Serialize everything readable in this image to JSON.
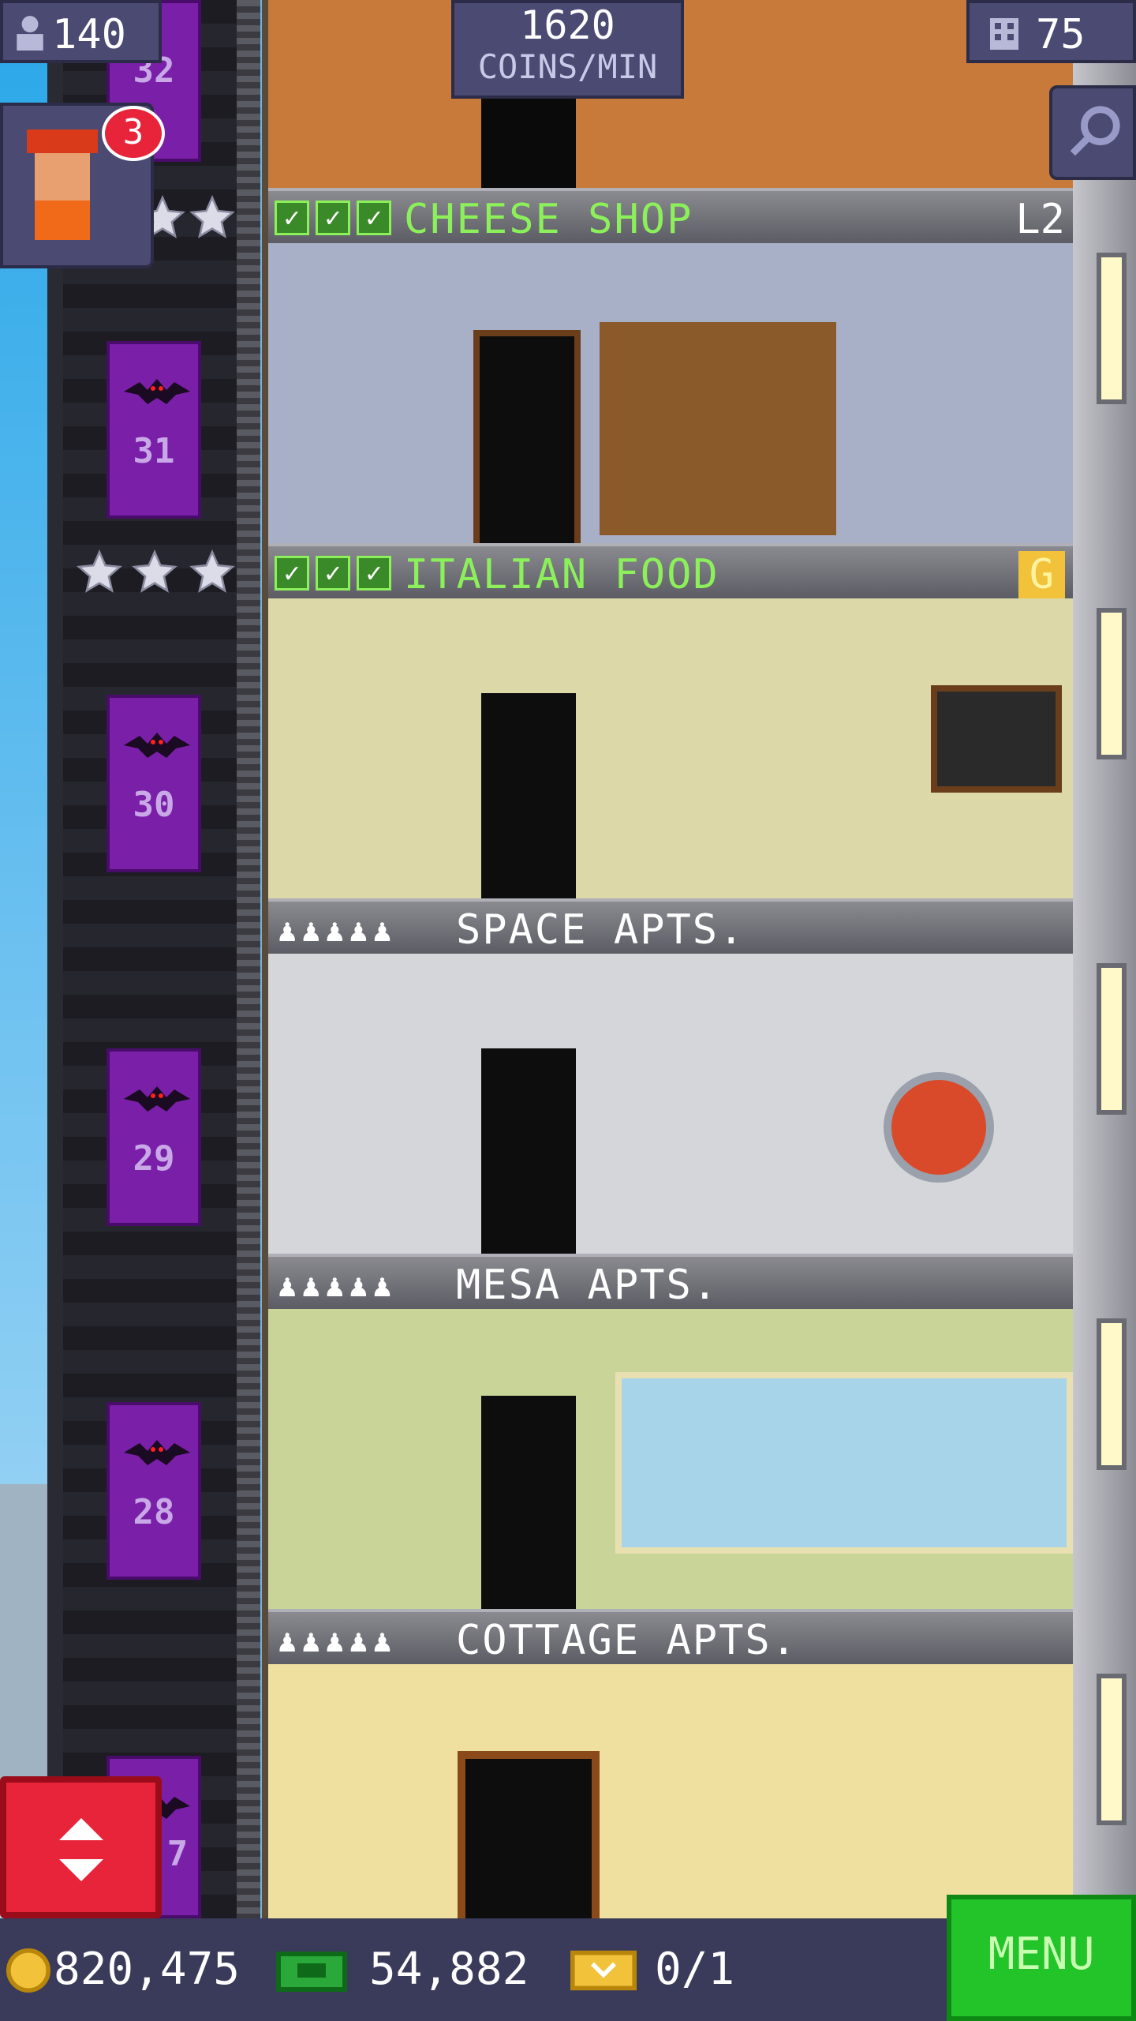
{
  "hud": {
    "population": "140",
    "coins_rate_value": "1620",
    "coins_rate_unit": "COINS/MIN",
    "floors_count": "75",
    "visitor_badge": "3"
  },
  "floors": [
    {
      "name": "CHEESE SHOP",
      "type": "business",
      "right_label": "L2",
      "elevator_number": "31"
    },
    {
      "name": "ITALIAN FOOD",
      "type": "business",
      "right_label": "G",
      "elevator_number": "30"
    },
    {
      "name": "SPACE APTS.",
      "type": "residential",
      "elevator_number": "29"
    },
    {
      "name": "MESA APTS.",
      "type": "residential",
      "elevator_number": "28"
    },
    {
      "name": "COTTAGE APTS.",
      "type": "residential",
      "elevator_number": "7"
    }
  ],
  "top_elevator_number": "32",
  "currency": {
    "coins": "820,475",
    "bux": "54,882",
    "tickets": "0/1"
  },
  "menu_label": "MENU",
  "colors": {
    "elevator_purple": "#7a1fa8",
    "menu_green": "#22c42a",
    "elevator_button_red": "#e8243a",
    "floor_label_green": "#8cf05a"
  },
  "icons": [
    "person-icon",
    "building-icon",
    "search-icon",
    "check-icon",
    "star-icon",
    "bat-icon",
    "coin-icon",
    "bux-icon",
    "ticket-icon",
    "elevator-arrows-icon"
  ]
}
